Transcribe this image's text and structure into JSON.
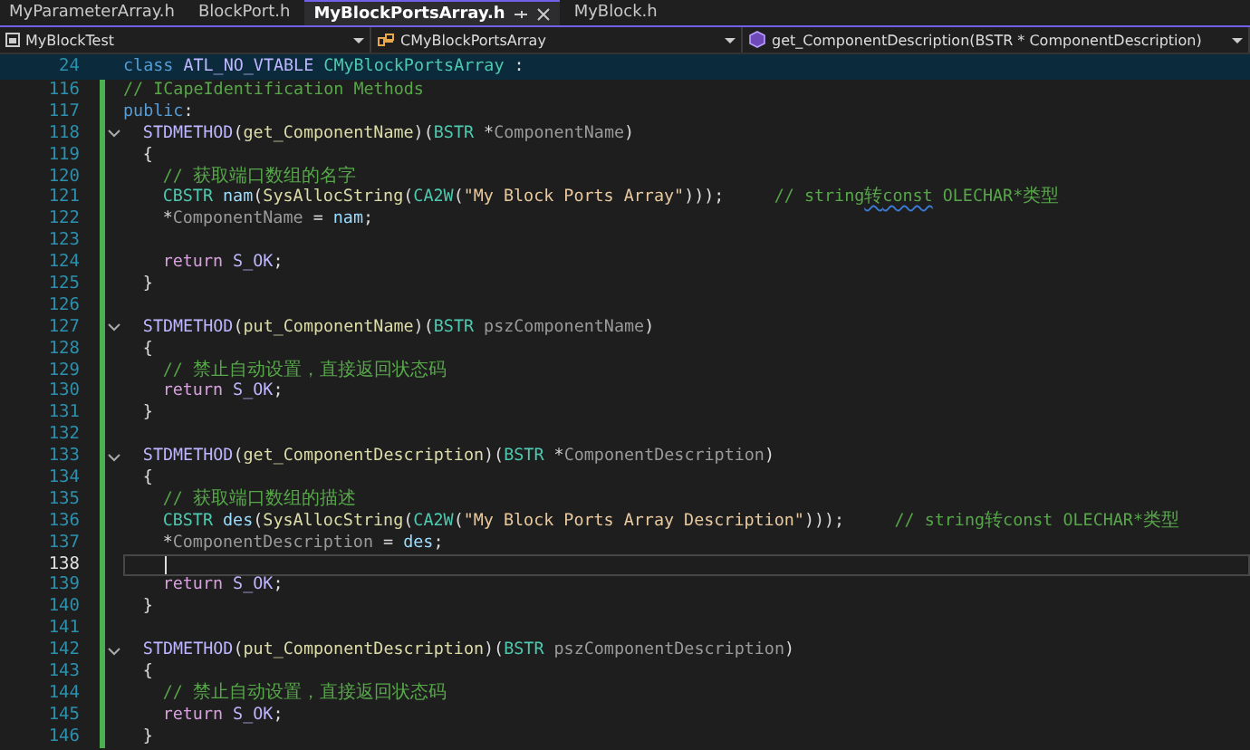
{
  "tabs": [
    {
      "label": "MyParameterArray.h",
      "selected": false
    },
    {
      "label": "BlockPort.h",
      "selected": false
    },
    {
      "label": "MyBlockPortsArray.h",
      "selected": true
    },
    {
      "label": "MyBlock.h",
      "selected": false
    }
  ],
  "navigation_bar": [
    {
      "kind": "project",
      "label": "MyBlockTest"
    },
    {
      "kind": "class",
      "label": "CMyBlockPortsArray"
    },
    {
      "kind": "method",
      "label": "get_ComponentDescription(BSTR * ComponentDescription)"
    }
  ],
  "sticky_line": {
    "number": "24",
    "tokens": [
      {
        "kind": "kw",
        "text": "class"
      },
      {
        "kind": "macro",
        "text": " ATL_NO_VTABLE"
      },
      {
        "kind": "type",
        "text": " CMyBlockPortsArray"
      },
      {
        "kind": "plain",
        "text": " :"
      }
    ]
  },
  "lines": [
    {
      "number": "116",
      "collapsible": false,
      "current": false,
      "tokens": [
        {
          "kind": "cmt",
          "text": "// ICapeIdentification Methods"
        }
      ]
    },
    {
      "number": "117",
      "collapsible": false,
      "current": false,
      "tokens": [
        {
          "kind": "kw",
          "text": "public"
        },
        {
          "kind": "plain",
          "text": ":"
        }
      ],
      "children": [
        {
          "number": "118",
          "collapsible": true,
          "current": false,
          "tokens": [
            {
              "kind": "macro",
              "text": "STDMETHOD"
            },
            {
              "kind": "plain",
              "text": "("
            },
            {
              "kind": "fn",
              "text": "get_ComponentName"
            },
            {
              "kind": "plain",
              "text": ")("
            },
            {
              "kind": "type",
              "text": "BSTR"
            },
            {
              "kind": "plain",
              "text": " *"
            },
            {
              "kind": "param",
              "text": "ComponentName"
            },
            {
              "kind": "plain",
              "text": ")"
            }
          ]
        },
        {
          "number": "119",
          "collapsible": false,
          "current": false,
          "tokens": [
            {
              "kind": "plain",
              "text": "{"
            }
          ],
          "children": [
            {
              "number": "120",
              "collapsible": false,
              "current": false,
              "tokens": [
                {
                  "kind": "cmt",
                  "text": "// 获取端口数组的名字"
                }
              ]
            },
            {
              "number": "121",
              "collapsible": false,
              "current": false,
              "tokens": [
                {
                  "kind": "type",
                  "text": "CBSTR"
                },
                {
                  "kind": "local",
                  "text": " nam"
                },
                {
                  "kind": "plain",
                  "text": "("
                },
                {
                  "kind": "fn",
                  "text": "SysAllocString"
                },
                {
                  "kind": "plain",
                  "text": "("
                },
                {
                  "kind": "type",
                  "text": "CA2W"
                },
                {
                  "kind": "plain",
                  "text": "("
                },
                {
                  "kind": "str",
                  "text": "\"My Block Ports Array\""
                },
                {
                  "kind": "plain",
                  "text": ")));     "
                },
                {
                  "kind": "cmt",
                  "text": "// string"
                },
                {
                  "kind": "cmtwarn",
                  "text": "转const"
                },
                {
                  "kind": "cmt",
                  "text": " OLECHAR*类型"
                }
              ]
            },
            {
              "number": "122",
              "collapsible": false,
              "current": false,
              "tokens": [
                {
                  "kind": "plain",
                  "text": "*"
                },
                {
                  "kind": "param",
                  "text": "ComponentName"
                },
                {
                  "kind": "plain",
                  "text": " = "
                },
                {
                  "kind": "local",
                  "text": "nam"
                },
                {
                  "kind": "plain",
                  "text": ";"
                }
              ]
            },
            {
              "number": "123",
              "collapsible": false,
              "current": false
            },
            {
              "number": "124",
              "collapsible": false,
              "current": false,
              "tokens": [
                {
                  "kind": "ret",
                  "text": "return"
                },
                {
                  "kind": "macro",
                  "text": " S_OK"
                },
                {
                  "kind": "plain",
                  "text": ";"
                }
              ]
            }
          ]
        },
        {
          "number": "125",
          "collapsible": false,
          "current": false,
          "tokens": [
            {
              "kind": "plain",
              "text": "}"
            }
          ]
        },
        {
          "number": "126",
          "collapsible": false,
          "current": false
        },
        {
          "number": "127",
          "collapsible": true,
          "current": false,
          "tokens": [
            {
              "kind": "macro",
              "text": "STDMETHOD"
            },
            {
              "kind": "plain",
              "text": "("
            },
            {
              "kind": "fn",
              "text": "put_ComponentName"
            },
            {
              "kind": "plain",
              "text": ")("
            },
            {
              "kind": "type",
              "text": "BSTR"
            },
            {
              "kind": "param",
              "text": " pszComponentName"
            },
            {
              "kind": "plain",
              "text": ")"
            }
          ]
        },
        {
          "number": "128",
          "collapsible": false,
          "current": false,
          "tokens": [
            {
              "kind": "plain",
              "text": "{"
            }
          ],
          "children": [
            {
              "number": "129",
              "collapsible": false,
              "current": false,
              "tokens": [
                {
                  "kind": "cmt",
                  "text": "// 禁止自动设置，直接返回状态码"
                }
              ]
            },
            {
              "number": "130",
              "collapsible": false,
              "current": false,
              "tokens": [
                {
                  "kind": "ret",
                  "text": "return"
                },
                {
                  "kind": "macro",
                  "text": " S_OK"
                },
                {
                  "kind": "plain",
                  "text": ";"
                }
              ]
            }
          ]
        },
        {
          "number": "131",
          "collapsible": false,
          "current": false,
          "tokens": [
            {
              "kind": "plain",
              "text": "}"
            }
          ]
        },
        {
          "number": "132",
          "collapsible": false,
          "current": false
        },
        {
          "number": "133",
          "collapsible": true,
          "current": false,
          "tokens": [
            {
              "kind": "macro",
              "text": "STDMETHOD"
            },
            {
              "kind": "plain",
              "text": "("
            },
            {
              "kind": "fn",
              "text": "get_ComponentDescription"
            },
            {
              "kind": "plain",
              "text": ")("
            },
            {
              "kind": "type",
              "text": "BSTR"
            },
            {
              "kind": "plain",
              "text": " *"
            },
            {
              "kind": "param",
              "text": "ComponentDescription"
            },
            {
              "kind": "plain",
              "text": ")"
            }
          ]
        },
        {
          "number": "134",
          "collapsible": false,
          "current": false,
          "tokens": [
            {
              "kind": "plain",
              "text": "{"
            }
          ],
          "children": [
            {
              "number": "135",
              "collapsible": false,
              "current": false,
              "tokens": [
                {
                  "kind": "cmt",
                  "text": "// 获取端口数组的描述"
                }
              ]
            },
            {
              "number": "136",
              "collapsible": false,
              "current": false,
              "tokens": [
                {
                  "kind": "type",
                  "text": "CBSTR"
                },
                {
                  "kind": "local",
                  "text": " des"
                },
                {
                  "kind": "plain",
                  "text": "("
                },
                {
                  "kind": "fn",
                  "text": "SysAllocString"
                },
                {
                  "kind": "plain",
                  "text": "("
                },
                {
                  "kind": "type",
                  "text": "CA2W"
                },
                {
                  "kind": "plain",
                  "text": "("
                },
                {
                  "kind": "str",
                  "text": "\"My Block Ports Array Description\""
                },
                {
                  "kind": "plain",
                  "text": ")));     "
                },
                {
                  "kind": "cmt",
                  "text": "// string转const OLECHAR*类型"
                }
              ]
            },
            {
              "number": "137",
              "collapsible": false,
              "current": false,
              "tokens": [
                {
                  "kind": "plain",
                  "text": "*"
                },
                {
                  "kind": "param",
                  "text": "ComponentDescription"
                },
                {
                  "kind": "plain",
                  "text": " = "
                },
                {
                  "kind": "local",
                  "text": "des"
                },
                {
                  "kind": "plain",
                  "text": ";"
                }
              ]
            },
            {
              "number": "138",
              "collapsible": false,
              "current": true
            },
            {
              "number": "139",
              "collapsible": false,
              "current": false,
              "tokens": [
                {
                  "kind": "ret",
                  "text": "return"
                },
                {
                  "kind": "macro",
                  "text": " S_OK"
                },
                {
                  "kind": "plain",
                  "text": ";"
                }
              ]
            }
          ]
        },
        {
          "number": "140",
          "collapsible": false,
          "current": false,
          "tokens": [
            {
              "kind": "plain",
              "text": "}"
            }
          ]
        },
        {
          "number": "141",
          "collapsible": false,
          "current": false
        },
        {
          "number": "142",
          "collapsible": true,
          "current": false,
          "tokens": [
            {
              "kind": "macro",
              "text": "STDMETHOD"
            },
            {
              "kind": "plain",
              "text": "("
            },
            {
              "kind": "fn",
              "text": "put_ComponentDescription"
            },
            {
              "kind": "plain",
              "text": ")("
            },
            {
              "kind": "type",
              "text": "BSTR"
            },
            {
              "kind": "param",
              "text": " pszComponentDescription"
            },
            {
              "kind": "plain",
              "text": ")"
            }
          ]
        },
        {
          "number": "143",
          "collapsible": false,
          "current": false,
          "tokens": [
            {
              "kind": "plain",
              "text": "{"
            }
          ],
          "children": [
            {
              "number": "144",
              "collapsible": false,
              "current": false,
              "tokens": [
                {
                  "kind": "cmt",
                  "text": "// 禁止自动设置，直接返回状态码"
                }
              ]
            },
            {
              "number": "145",
              "collapsible": false,
              "current": false,
              "tokens": [
                {
                  "kind": "ret",
                  "text": "return"
                },
                {
                  "kind": "macro",
                  "text": " S_OK"
                },
                {
                  "kind": "plain",
                  "text": ";"
                }
              ]
            }
          ]
        },
        {
          "number": "146",
          "collapsible": false,
          "current": false,
          "tokens": [
            {
              "kind": "plain",
              "text": "}"
            }
          ]
        }
      ]
    }
  ]
}
